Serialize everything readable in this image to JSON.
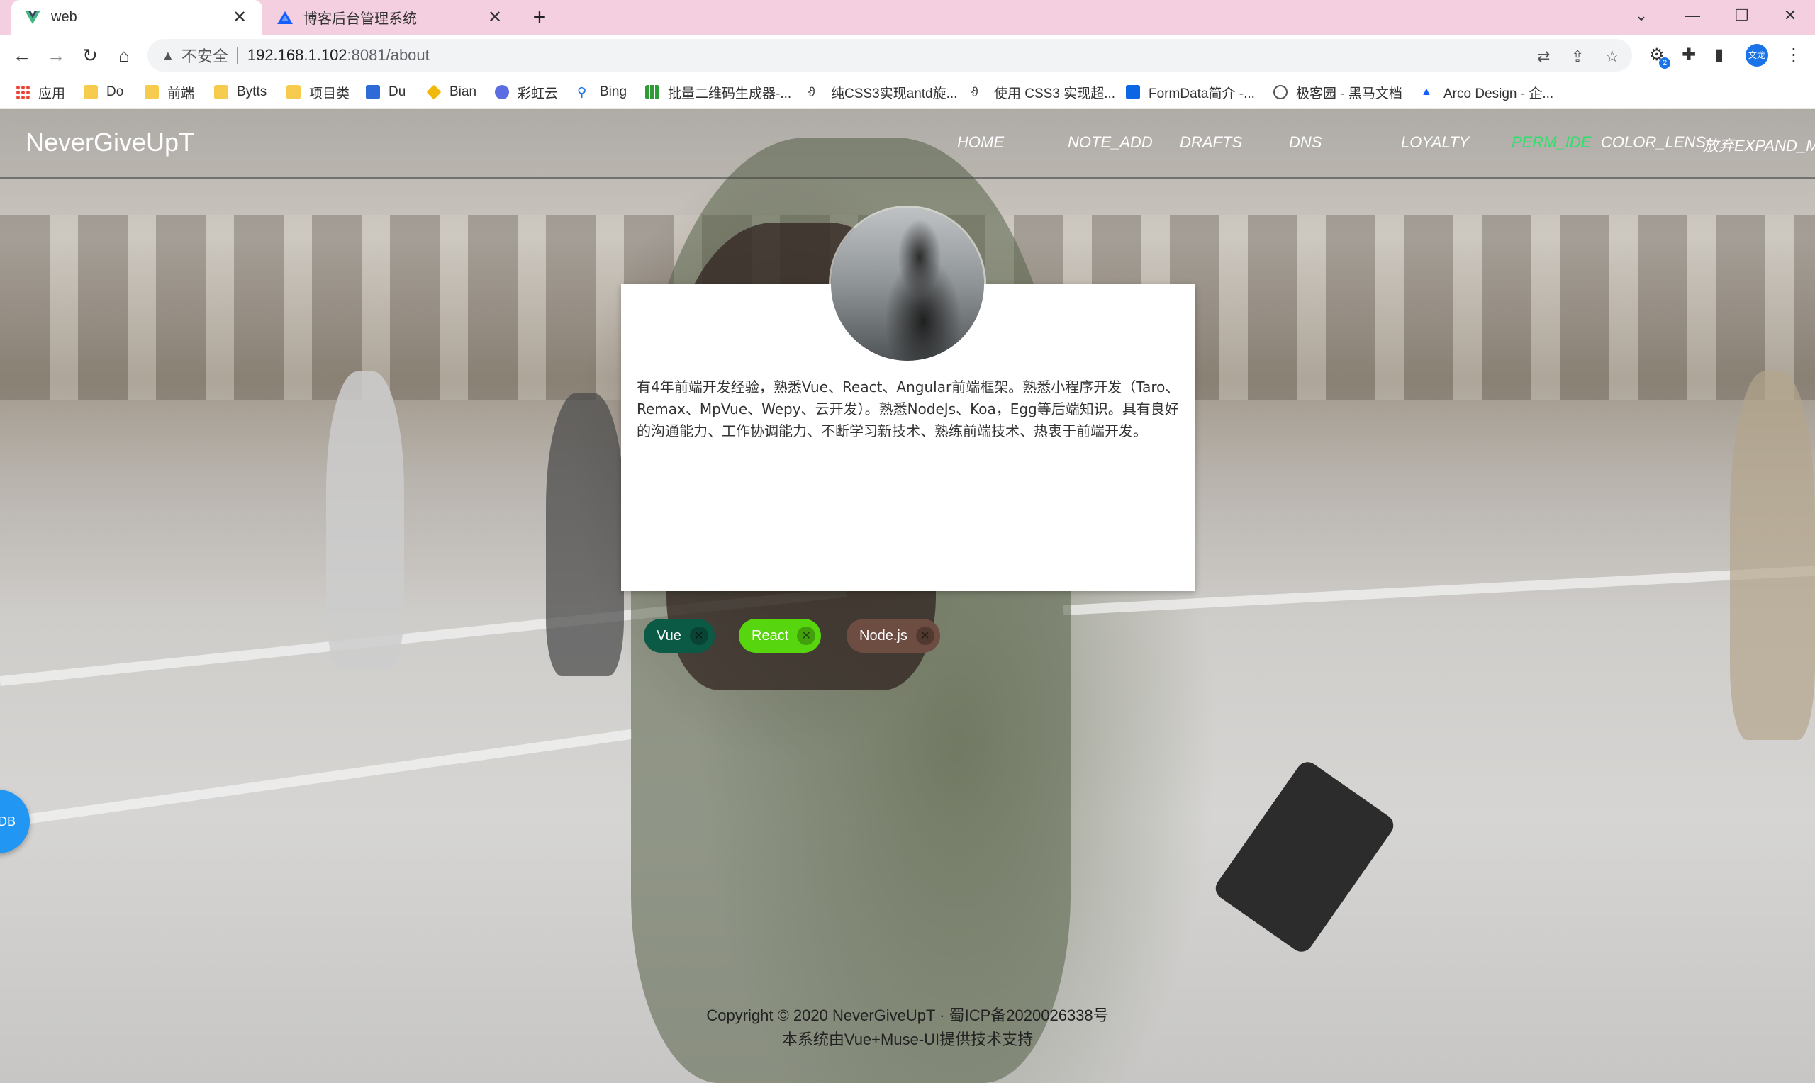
{
  "browser": {
    "tabs": [
      {
        "title": "web"
      },
      {
        "title": "博客后台管理系统"
      }
    ],
    "url": {
      "insecure_label": "不安全",
      "host": "192.168.1.102",
      "path": ":8081/about"
    },
    "profile_label": "文龙",
    "ext_badge": "2",
    "bookmarks": [
      {
        "label": "应用"
      },
      {
        "label": "Do"
      },
      {
        "label": "前端"
      },
      {
        "label": "Bytts"
      },
      {
        "label": "项目类"
      },
      {
        "label": "Du"
      },
      {
        "label": "Bian"
      },
      {
        "label": "彩虹云"
      },
      {
        "label": "Bing"
      },
      {
        "label": "批量二维码生成器-..."
      },
      {
        "label": "纯CSS3实现antd旋..."
      },
      {
        "label": "使用 CSS3 实现超..."
      },
      {
        "label": "FormData简介 -..."
      },
      {
        "label": "极客园 - 黑马文档"
      },
      {
        "label": "Arco Design - 企..."
      }
    ]
  },
  "site": {
    "brand": "NeverGiveUpT",
    "nav": [
      {
        "label": "HOME"
      },
      {
        "label": "NOTE_ADD"
      },
      {
        "label": "DRAFTS"
      },
      {
        "label": "DNS"
      },
      {
        "label": "LOYALTY"
      },
      {
        "label": "PERM_IDE"
      },
      {
        "label": "COLOR_LENS"
      },
      {
        "label": "放弃EXPAND_M"
      }
    ],
    "bio": "有4年前端开发经验，熟悉Vue、React、Angular前端框架。熟悉小程序开发（Taro、Remax、MpVue、Wepy、云开发）。熟悉NodeJs、Koa，Egg等后端知识。具有良好的沟通能力、工作协调能力、不断学习新技术、熟练前端技术、热衷于前端开发。",
    "chips": [
      {
        "label": "Vue",
        "color": "#0b5a46"
      },
      {
        "label": "React",
        "color": "#57d60f"
      },
      {
        "label": "Node.js",
        "color": "#6d4c41"
      }
    ],
    "float_button": "DB",
    "footer": {
      "copyright": "Copyright © 2020 NeverGiveUpT · 蜀ICP备2020026338号",
      "tech": "本系统由Vue+Muse-UI提供技术支持"
    }
  }
}
